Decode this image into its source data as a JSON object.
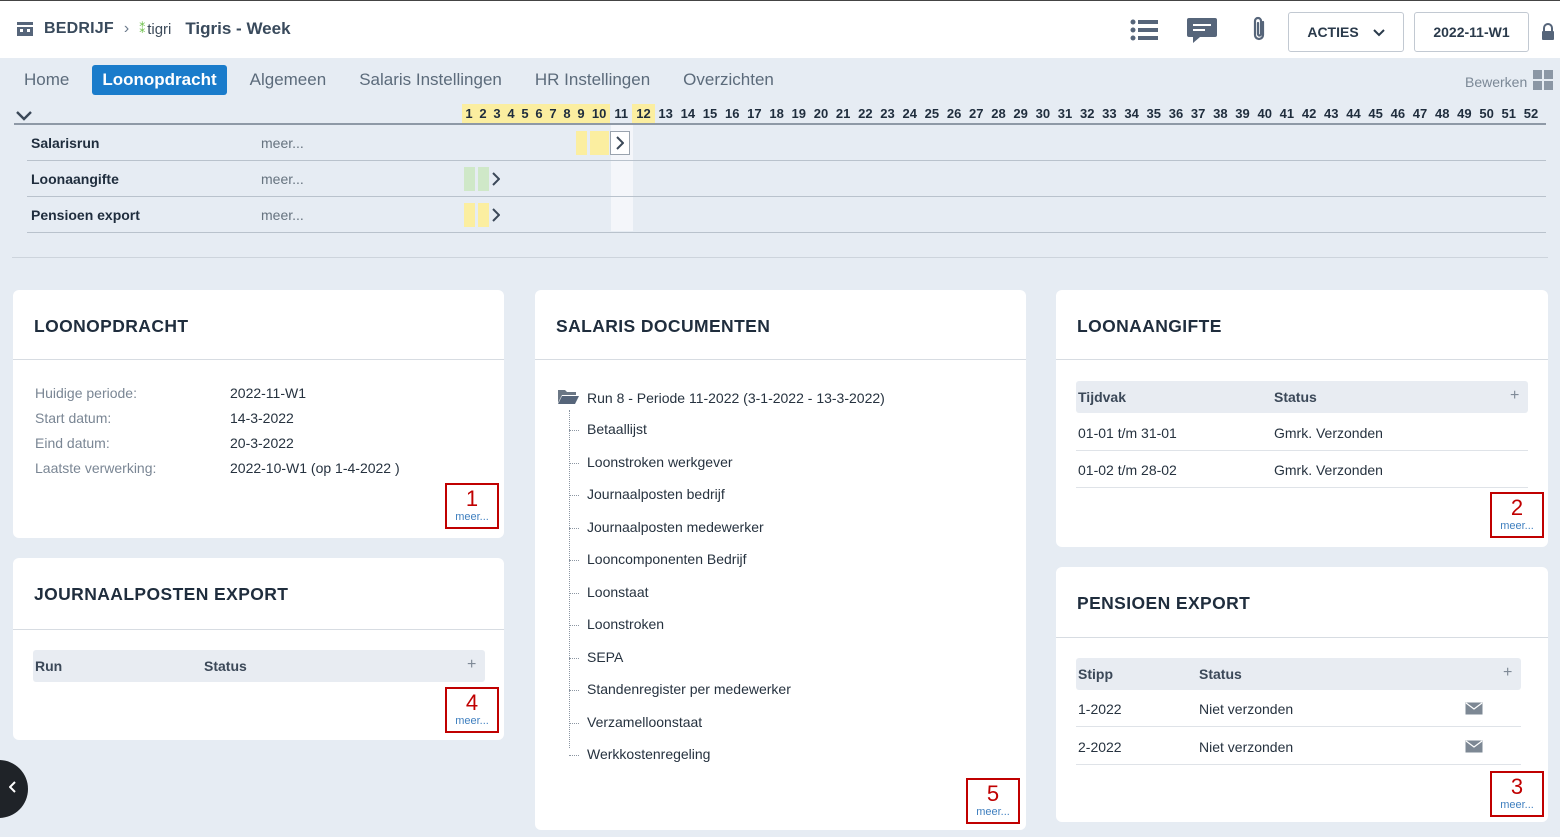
{
  "header": {
    "company": "BEDRIJF",
    "logo_text": "tigri",
    "title": "Tigris - Week",
    "acties_label": "ACTIES",
    "period_label": "2022-11-W1",
    "icons": [
      "building-icon",
      "list-icon",
      "chat-icon",
      "paperclip-icon",
      "lock-icon"
    ]
  },
  "tabs": [
    {
      "label": "Home",
      "active": false
    },
    {
      "label": "Loonopdracht",
      "active": true
    },
    {
      "label": "Algemeen",
      "active": false
    },
    {
      "label": "Salaris Instellingen",
      "active": false
    },
    {
      "label": "HR Instellingen",
      "active": false
    },
    {
      "label": "Overzichten",
      "active": false
    }
  ],
  "bewerken_label": "Bewerken",
  "timeline": {
    "weeks": [
      "1",
      "2",
      "3",
      "4",
      "5",
      "6",
      "7",
      "8",
      "9",
      "10",
      "11",
      "12",
      "13",
      "14",
      "15",
      "16",
      "17",
      "18",
      "19",
      "20",
      "21",
      "22",
      "23",
      "24",
      "25",
      "26",
      "27",
      "28",
      "29",
      "30",
      "31",
      "32",
      "33",
      "34",
      "35",
      "36",
      "37",
      "38",
      "39",
      "40",
      "41",
      "42",
      "43",
      "44",
      "45",
      "46",
      "47",
      "48",
      "49",
      "50",
      "51",
      "52"
    ],
    "highlighted_weeks": [
      "1",
      "2",
      "3",
      "4",
      "5",
      "6",
      "7",
      "8",
      "9",
      "10",
      "12"
    ],
    "current_week": "11",
    "rows": [
      {
        "label": "Salarisrun",
        "meer": "meer...",
        "bar_weeks": [
          "9",
          "10"
        ],
        "bar_color": "yellow",
        "arrow_week": "11"
      },
      {
        "label": "Loonaangifte",
        "meer": "meer...",
        "bar_weeks": [
          "1",
          "2"
        ],
        "bar_color": "green",
        "arrow_week": "3"
      },
      {
        "label": "Pensioen export",
        "meer": "meer...",
        "bar_weeks": [
          "1",
          "2"
        ],
        "bar_color": "yellow",
        "arrow_week": "3"
      }
    ]
  },
  "loonopdracht": {
    "title": "LOONOPDRACHT",
    "rows": [
      {
        "k": "Huidige periode:",
        "v": "2022-11-W1"
      },
      {
        "k": "Start datum:",
        "v": "14-3-2022"
      },
      {
        "k": "Eind datum:",
        "v": "20-3-2022"
      },
      {
        "k": "Laatste verwerking:",
        "v": "2022-10-W1 (op 1-4-2022 )"
      }
    ],
    "badge_num": "1",
    "badge_link": "meer..."
  },
  "journaalposten": {
    "title": "JOURNAALPOSTEN EXPORT",
    "col1": "Run",
    "col2": "Status",
    "plus": "+",
    "badge_num": "4",
    "badge_link": "meer..."
  },
  "salaris_documenten": {
    "title": "SALARIS DOCUMENTEN",
    "root": "Run 8 - Periode 11-2022 (3-1-2022 - 13-3-2022)",
    "items": [
      "Betaallijst",
      "Loonstroken werkgever",
      "Journaalposten bedrijf",
      "Journaalposten medewerker",
      "Looncomponenten Bedrijf",
      "Loonstaat",
      "Loonstroken",
      "SEPA",
      "Standenregister per medewerker",
      "Verzamelloonstaat",
      "Werkkostenregeling"
    ],
    "badge_num": "5",
    "badge_link": "meer..."
  },
  "loonaangifte": {
    "title": "LOONAANGIFTE",
    "col1": "Tijdvak",
    "col2": "Status",
    "plus": "+",
    "rows": [
      {
        "tijdvak": "01-01 t/m 31-01",
        "status": "Gmrk. Verzonden"
      },
      {
        "tijdvak": "01-02 t/m 28-02",
        "status": "Gmrk. Verzonden"
      }
    ],
    "badge_num": "2",
    "badge_link": "meer..."
  },
  "pensioen": {
    "title": "PENSIOEN EXPORT",
    "col1": "Stipp",
    "col2": "Status",
    "plus": "+",
    "rows": [
      {
        "stipp": "1-2022",
        "status": "Niet verzonden",
        "icon": "envelope-icon"
      },
      {
        "stipp": "2-2022",
        "status": "Niet verzonden",
        "icon": "envelope-icon"
      }
    ],
    "badge_num": "3",
    "badge_link": "meer..."
  }
}
